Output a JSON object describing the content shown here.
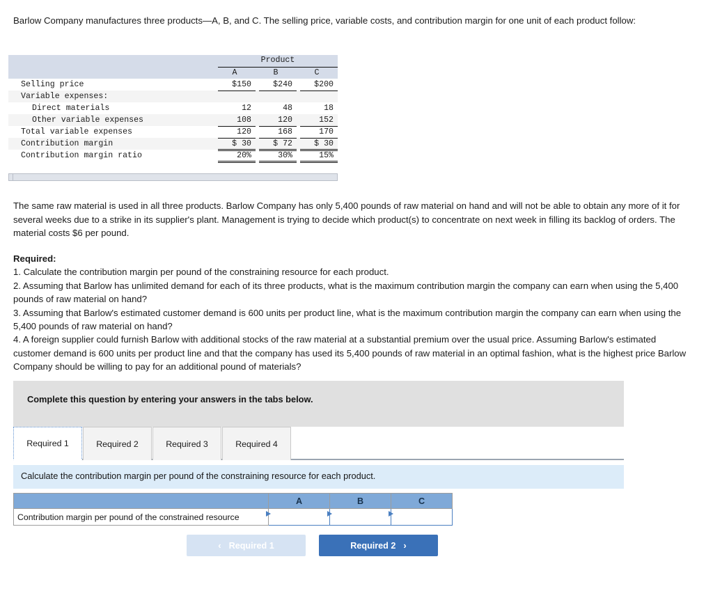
{
  "intro": {
    "paragraph": "Barlow Company manufactures three products—A, B, and C. The selling price, variable costs, and contribution margin for one unit of each product follow:"
  },
  "data_table": {
    "group_header": "Product",
    "columns": [
      "A",
      "B",
      "C"
    ],
    "rows": [
      {
        "label": "Selling price",
        "indent": false,
        "values": [
          "$150",
          "$240",
          "$200"
        ],
        "has_dollar": true,
        "underline": "single"
      },
      {
        "label": "Variable expenses:",
        "indent": false,
        "values": [
          "",
          "",
          ""
        ],
        "has_dollar": false,
        "underline": "none"
      },
      {
        "label": "Direct materials",
        "indent": true,
        "values": [
          "12",
          "48",
          "18"
        ],
        "has_dollar": false,
        "underline": "none"
      },
      {
        "label": "Other variable expenses",
        "indent": true,
        "values": [
          "108",
          "120",
          "152"
        ],
        "has_dollar": false,
        "underline": "single"
      },
      {
        "label": "Total variable expenses",
        "indent": false,
        "values": [
          "120",
          "168",
          "170"
        ],
        "has_dollar": false,
        "underline": "single"
      },
      {
        "label": "Contribution margin",
        "indent": false,
        "values": [
          "$  30",
          "$  72",
          "$  30"
        ],
        "has_dollar": true,
        "underline": "double"
      },
      {
        "label": "Contribution margin ratio",
        "indent": false,
        "values": [
          "20%",
          "30%",
          "15%"
        ],
        "has_dollar": false,
        "underline": "double"
      }
    ]
  },
  "mid_paragraph": "The same raw material is used in all three products. Barlow Company has only 5,400 pounds of raw material on hand and will not be able to obtain any more of it for several weeks due to a strike in its supplier's plant. Management is trying to decide which product(s) to concentrate on next week in filling its backlog of orders. The material costs $6 per pound.",
  "required": {
    "heading": "Required:",
    "items": [
      "1. Calculate the contribution margin per pound of the constraining resource for each product.",
      "2. Assuming that Barlow has unlimited demand for each of its three products, what is the maximum contribution margin the company can earn when using the 5,400 pounds of raw material on hand?",
      "3. Assuming that Barlow's estimated customer demand is 600 units per product line, what is the maximum contribution margin the company can earn when using the 5,400 pounds of raw material on hand?",
      "4. A foreign supplier could furnish Barlow with additional stocks of the raw material at a substantial premium over the usual price. Assuming Barlow's estimated customer demand is 600 units per product line and that the company has used its 5,400 pounds of raw material in an optimal fashion, what is the highest price Barlow Company should be willing to pay for an additional pound of materials?"
    ]
  },
  "gray_banner": {
    "text": "Complete this question by entering your answers in the tabs below."
  },
  "tabs": [
    {
      "label": "Required 1",
      "active": true
    },
    {
      "label": "Required 2",
      "active": false
    },
    {
      "label": "Required 3",
      "active": false
    },
    {
      "label": "Required 4",
      "active": false
    }
  ],
  "prompt_bar": {
    "text": "Calculate the contribution margin per pound of the constraining resource for each product."
  },
  "answer_table": {
    "header_blank": "",
    "columns": [
      "A",
      "B",
      "C"
    ],
    "row_label": "Contribution margin per pound of the constrained resource",
    "values": [
      "",
      "",
      ""
    ],
    "placeholder": ""
  },
  "nav": {
    "prev_label": "Required 1",
    "prev_chevron": "‹",
    "next_label": "Required 2",
    "next_chevron": "›"
  },
  "colors": {
    "table_header_bg": "#d5dce9",
    "zebra_row": "#f4f4f4",
    "gray_banner": "#e0e0e0",
    "prompt_bar": "#dcecf9",
    "answer_header_blue": "#7fa9d8",
    "button_active": "#3a71b8",
    "button_disabled": "#d6e3f3",
    "focus_outline": "#5b8fd0"
  }
}
